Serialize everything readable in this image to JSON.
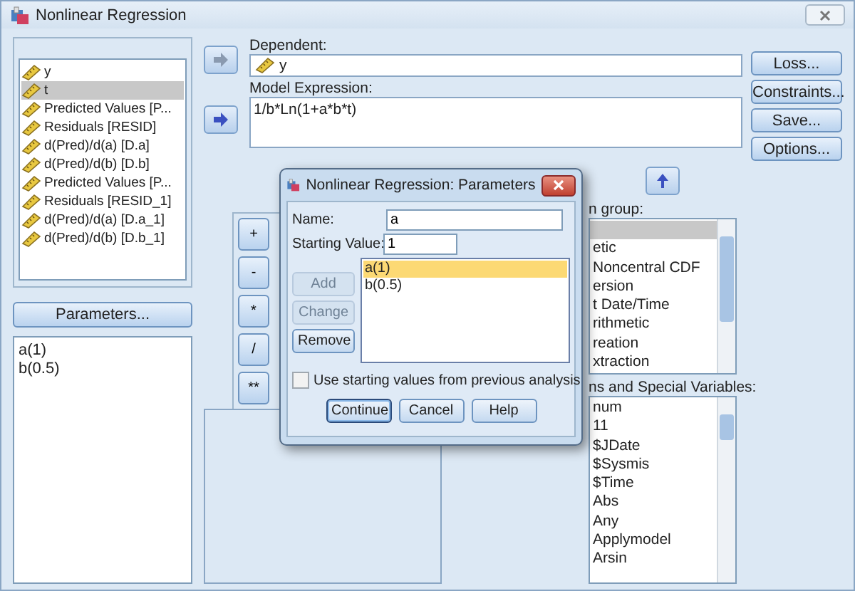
{
  "window": {
    "title": "Nonlinear Regression"
  },
  "variables": [
    {
      "label": "y",
      "selected": false
    },
    {
      "label": "t",
      "selected": true
    },
    {
      "label": "Predicted Values [P...",
      "selected": false
    },
    {
      "label": "Residuals [RESID]",
      "selected": false
    },
    {
      "label": "d(Pred)/d(a) [D.a]",
      "selected": false
    },
    {
      "label": "d(Pred)/d(b) [D.b]",
      "selected": false
    },
    {
      "label": "Predicted Values [P...",
      "selected": false
    },
    {
      "label": "Residuals [RESID_1]",
      "selected": false
    },
    {
      "label": "d(Pred)/d(a) [D.a_1]",
      "selected": false
    },
    {
      "label": "d(Pred)/d(b) [D.b_1]",
      "selected": false
    }
  ],
  "parameters_button": "Parameters...",
  "parameters": [
    "a(1)",
    "b(0.5)"
  ],
  "dependent": {
    "label": "Dependent:",
    "value": "y"
  },
  "model_expression": {
    "label": "Model Expression:",
    "value": "1/b*Ln(1+a*b*t)"
  },
  "side_buttons": [
    "Loss...",
    "Constraints...",
    "Save...",
    "Options..."
  ],
  "keypad": [
    "+",
    "-",
    "*",
    "/",
    "**"
  ],
  "function_group": {
    "label": "n group:",
    "items": [
      {
        "selected": true
      },
      {
        "label": "etic",
        "selected": false
      },
      {
        "label": "Noncentral CDF",
        "selected": false
      },
      {
        "label": "ersion",
        "selected": false
      },
      {
        "label": "t Date/Time",
        "selected": false
      },
      {
        "label": "rithmetic",
        "selected": false
      },
      {
        "label": "reation",
        "selected": false
      },
      {
        "label": "xtraction",
        "selected": false
      }
    ]
  },
  "functions": {
    "label": "ns and Special Variables:",
    "items": [
      "num",
      "11",
      "$JDate",
      "$Sysmis",
      "$Time",
      "Abs",
      "Any",
      "Applymodel",
      "Arsin"
    ]
  },
  "dialog": {
    "title": "Nonlinear Regression: Parameters",
    "name": {
      "label": "Name:",
      "value": "a"
    },
    "starting_value": {
      "label": "Starting Value:",
      "value": "1"
    },
    "buttons": [
      {
        "label": "Add",
        "disabled": true
      },
      {
        "label": "Change",
        "disabled": true
      },
      {
        "label": "Remove",
        "disabled": false
      }
    ],
    "list": [
      {
        "label": "a(1)",
        "selected": true
      },
      {
        "label": "b(0.5)",
        "selected": false
      }
    ],
    "use_previous": {
      "label": "Use starting values from previous analysis",
      "checked": false
    },
    "actions": [
      {
        "label": "Continue",
        "default": true
      },
      {
        "label": "Cancel",
        "default": false
      },
      {
        "label": "Help",
        "default": false
      }
    ]
  }
}
